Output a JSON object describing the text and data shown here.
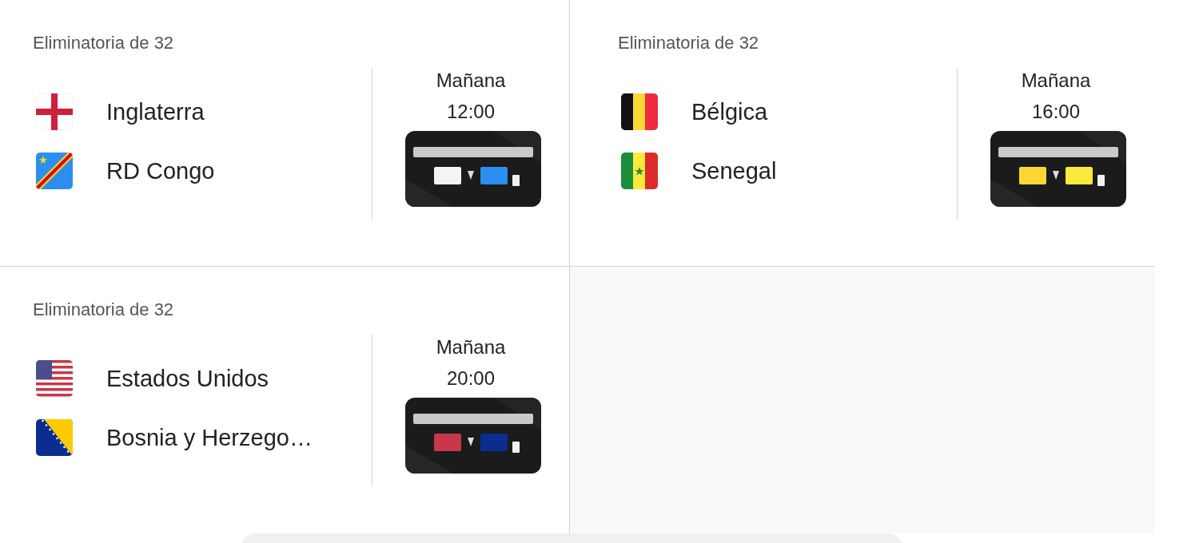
{
  "matches": [
    {
      "round": "Eliminatoria de 32",
      "day": "Mañana",
      "time": "12:00",
      "highlight": {
        "kind": "picture"
      },
      "teams": [
        {
          "name": "Inglaterra",
          "kind": "england"
        },
        {
          "name": "RD Congo",
          "kind": "drcongo"
        }
      ]
    },
    {
      "round": "Eliminatoria de 32",
      "day": "Mañana",
      "time": "16:00",
      "highlight": {
        "kind": "picture"
      },
      "teams": [
        {
          "name": "Bélgica",
          "kind": "belgium"
        },
        {
          "name": "Senegal",
          "kind": "senegal"
        }
      ]
    },
    {
      "round": "Eliminatoria de 32",
      "day": "Mañana",
      "time": "20:00",
      "highlight": {
        "kind": "picture"
      },
      "teams": [
        {
          "name": "Estados Unidos",
          "kind": "usa"
        },
        {
          "name": "Bosnia y Herzego…",
          "kind": "bosnia"
        }
      ]
    }
  ]
}
